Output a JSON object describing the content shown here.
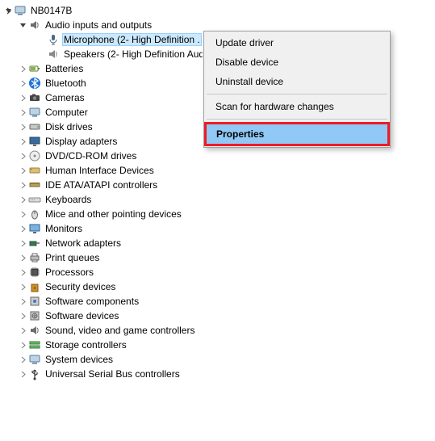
{
  "root": {
    "label": "NB0147B"
  },
  "audio": {
    "group": "Audio inputs and outputs",
    "mic": "Microphone (2- High Definition .",
    "spk": "Speakers (2- High Definition Aud"
  },
  "categories": [
    "Batteries",
    "Bluetooth",
    "Cameras",
    "Computer",
    "Disk drives",
    "Display adapters",
    "DVD/CD-ROM drives",
    "Human Interface Devices",
    "IDE ATA/ATAPI controllers",
    "Keyboards",
    "Mice and other pointing devices",
    "Monitors",
    "Network adapters",
    "Print queues",
    "Processors",
    "Security devices",
    "Software components",
    "Software devices",
    "Sound, video and game controllers",
    "Storage controllers",
    "System devices",
    "Universal Serial Bus controllers"
  ],
  "context_menu": {
    "update": "Update driver",
    "disable": "Disable device",
    "uninstall": "Uninstall device",
    "scan": "Scan for hardware changes",
    "properties": "Properties"
  }
}
